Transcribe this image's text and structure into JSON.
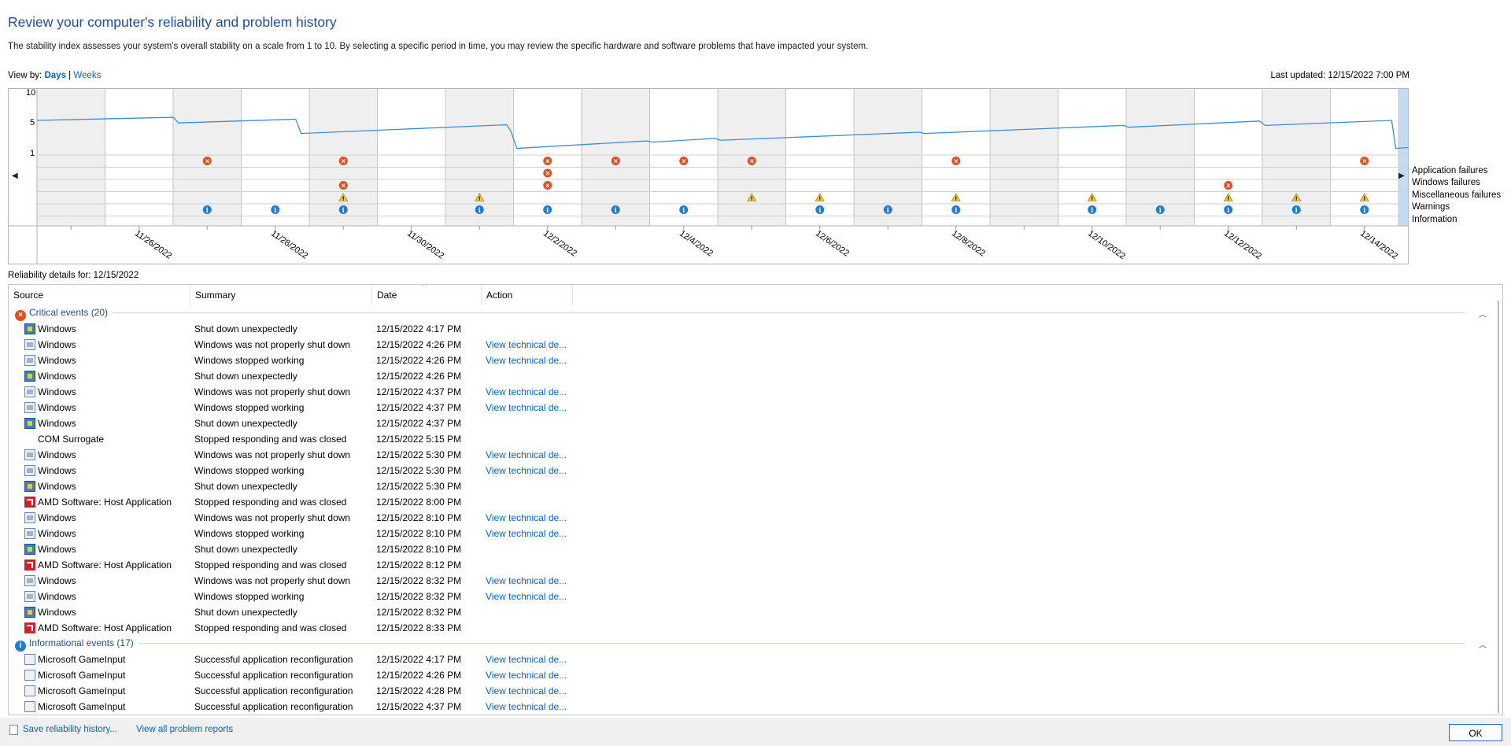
{
  "header": {
    "title": "Review your computer's reliability and problem history",
    "description": "The stability index assesses your system's overall stability on a scale from 1 to 10. By selecting a specific period in time, you may review the specific hardware and software problems that have impacted your system.",
    "view_by_label": "View by:",
    "view_days": "Days",
    "view_sep": "|",
    "view_weeks": "Weeks",
    "last_updated": "Last updated: 12/15/2022 7:00 PM"
  },
  "chart": {
    "y_ticks": [
      "10",
      "5",
      "1"
    ],
    "date_labels": [
      "11/26/2022",
      "11/28/2022",
      "11/30/2022",
      "12/2/2022",
      "12/4/2022",
      "12/6/2022",
      "12/8/2022",
      "12/10/2022",
      "12/12/2022",
      "12/14/2022"
    ],
    "row_labels": [
      "Application failures",
      "Windows failures",
      "Miscellaneous failures",
      "Warnings",
      "Information"
    ],
    "selected_day": "12/15/2022",
    "colors": {
      "line": "#3a8de0",
      "selected": "#c3dcf4",
      "shade": "#efefef",
      "critical": "#e24d22",
      "warning": "#f4c63d",
      "info": "#1f7dd1"
    }
  },
  "chart_data": {
    "type": "line",
    "title": "",
    "ylim": [
      1,
      10
    ],
    "days": [
      "11/25/2022",
      "11/26/2022",
      "11/27/2022",
      "11/28/2022",
      "11/29/2022",
      "11/30/2022",
      "12/1/2022",
      "12/2/2022",
      "12/3/2022",
      "12/4/2022",
      "12/5/2022",
      "12/6/2022",
      "12/7/2022",
      "12/8/2022",
      "12/9/2022",
      "12/10/2022",
      "12/11/2022",
      "12/12/2022",
      "12/13/2022",
      "12/14/2022",
      "12/15/2022"
    ],
    "stability_index": [
      [
        0,
        6.7
      ],
      [
        2,
        7.2
      ],
      [
        2.08,
        6.3
      ],
      [
        3.8,
        6.9
      ],
      [
        3.88,
        4.6
      ],
      [
        6.9,
        6.0
      ],
      [
        6.96,
        5.0
      ],
      [
        7.05,
        2.2
      ],
      [
        8.96,
        3.4
      ],
      [
        9.04,
        3.2
      ],
      [
        9.96,
        3.8
      ],
      [
        10.04,
        3.5
      ],
      [
        12.96,
        4.8
      ],
      [
        13.04,
        4.6
      ],
      [
        15.96,
        5.9
      ],
      [
        16.04,
        5.6
      ],
      [
        17.96,
        6.6
      ],
      [
        18.04,
        5.9
      ],
      [
        19.9,
        6.7
      ],
      [
        19.96,
        2.2
      ],
      [
        20.8,
        2.8
      ],
      [
        20.9,
        1.6
      ],
      [
        21,
        1.6
      ]
    ],
    "events": {
      "application_failures": [
        2,
        4,
        7,
        8,
        9,
        10,
        13,
        19,
        20
      ],
      "windows_failures": [
        7,
        20
      ],
      "miscellaneous_failures": [
        4,
        7,
        17,
        20
      ],
      "warnings": [
        4,
        6,
        10,
        11,
        13,
        15,
        17,
        18,
        19
      ],
      "information": [
        2,
        3,
        4,
        6,
        7,
        8,
        9,
        11,
        12,
        13,
        15,
        16,
        17,
        18,
        19,
        20
      ]
    }
  },
  "details": {
    "label": "Reliability details for: 12/15/2022",
    "columns": [
      "Source",
      "Summary",
      "Date",
      "Action"
    ],
    "groups": [
      {
        "title": "Critical events (20)",
        "type": "critical",
        "rows": [
          {
            "icon": "sd",
            "source": "Windows",
            "summary": "Shut down unexpectedly",
            "date": "12/15/2022 4:17 PM",
            "action": ""
          },
          {
            "icon": "win",
            "source": "Windows",
            "summary": "Windows was not properly shut down",
            "date": "12/15/2022 4:26 PM",
            "action": "View technical de..."
          },
          {
            "icon": "win",
            "source": "Windows",
            "summary": "Windows stopped working",
            "date": "12/15/2022 4:26 PM",
            "action": "View technical de..."
          },
          {
            "icon": "sd",
            "source": "Windows",
            "summary": "Shut down unexpectedly",
            "date": "12/15/2022 4:26 PM",
            "action": ""
          },
          {
            "icon": "win",
            "source": "Windows",
            "summary": "Windows was not properly shut down",
            "date": "12/15/2022 4:37 PM",
            "action": "View technical de..."
          },
          {
            "icon": "win",
            "source": "Windows",
            "summary": "Windows stopped working",
            "date": "12/15/2022 4:37 PM",
            "action": "View technical de..."
          },
          {
            "icon": "sd",
            "source": "Windows",
            "summary": "Shut down unexpectedly",
            "date": "12/15/2022 4:37 PM",
            "action": ""
          },
          {
            "icon": "none",
            "source": "COM Surrogate",
            "summary": "Stopped responding and was closed",
            "date": "12/15/2022 5:15 PM",
            "action": ""
          },
          {
            "icon": "win",
            "source": "Windows",
            "summary": "Windows was not properly shut down",
            "date": "12/15/2022 5:30 PM",
            "action": "View technical de..."
          },
          {
            "icon": "win",
            "source": "Windows",
            "summary": "Windows stopped working",
            "date": "12/15/2022 5:30 PM",
            "action": "View technical de..."
          },
          {
            "icon": "sd",
            "source": "Windows",
            "summary": "Shut down unexpectedly",
            "date": "12/15/2022 5:30 PM",
            "action": ""
          },
          {
            "icon": "amd",
            "source": "AMD Software: Host Application",
            "summary": "Stopped responding and was closed",
            "date": "12/15/2022 8:00 PM",
            "action": ""
          },
          {
            "icon": "win",
            "source": "Windows",
            "summary": "Windows was not properly shut down",
            "date": "12/15/2022 8:10 PM",
            "action": "View technical de..."
          },
          {
            "icon": "win",
            "source": "Windows",
            "summary": "Windows stopped working",
            "date": "12/15/2022 8:10 PM",
            "action": "View technical de..."
          },
          {
            "icon": "sd",
            "source": "Windows",
            "summary": "Shut down unexpectedly",
            "date": "12/15/2022 8:10 PM",
            "action": ""
          },
          {
            "icon": "amd",
            "source": "AMD Software: Host Application",
            "summary": "Stopped responding and was closed",
            "date": "12/15/2022 8:12 PM",
            "action": ""
          },
          {
            "icon": "win",
            "source": "Windows",
            "summary": "Windows was not properly shut down",
            "date": "12/15/2022 8:32 PM",
            "action": "View technical de..."
          },
          {
            "icon": "win",
            "source": "Windows",
            "summary": "Windows stopped working",
            "date": "12/15/2022 8:32 PM",
            "action": "View technical de..."
          },
          {
            "icon": "sd",
            "source": "Windows",
            "summary": "Shut down unexpectedly",
            "date": "12/15/2022 8:32 PM",
            "action": ""
          },
          {
            "icon": "amd",
            "source": "AMD Software: Host Application",
            "summary": "Stopped responding and was closed",
            "date": "12/15/2022 8:33 PM",
            "action": ""
          }
        ]
      },
      {
        "title": "Informational events (17)",
        "type": "info",
        "rows": [
          {
            "icon": "app",
            "source": "Microsoft GameInput",
            "summary": "Successful application reconfiguration",
            "date": "12/15/2022 4:17 PM",
            "action": "View technical de..."
          },
          {
            "icon": "app",
            "source": "Microsoft GameInput",
            "summary": "Successful application reconfiguration",
            "date": "12/15/2022 4:26 PM",
            "action": "View technical de..."
          },
          {
            "icon": "app",
            "source": "Microsoft GameInput",
            "summary": "Successful application reconfiguration",
            "date": "12/15/2022 4:28 PM",
            "action": "View technical de..."
          },
          {
            "icon": "app",
            "source": "Microsoft GameInput",
            "summary": "Successful application reconfiguration",
            "date": "12/15/2022 4:37 PM",
            "action": "View technical de..."
          }
        ]
      }
    ]
  },
  "footer": {
    "save_link": "Save reliability history...",
    "view_all_link": "View all problem reports",
    "ok_label": "OK"
  }
}
